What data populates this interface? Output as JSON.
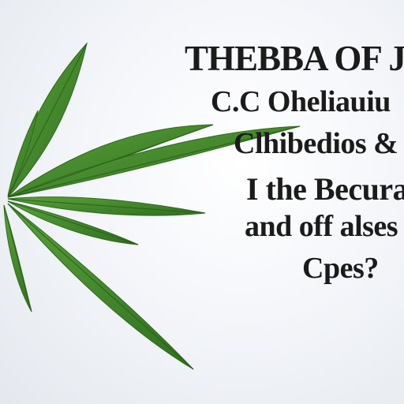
{
  "image": {
    "subject": "cannabis leaf",
    "background_color": "#f2f4f8",
    "leaf_color": "#3f8a2a"
  },
  "headline": {
    "lines": [
      "THEBBA OF Ju",
      "C.C Oheliauiu",
      "Clhibedios &",
      "I the Becura",
      "and off alses",
      "Cpes?"
    ]
  }
}
